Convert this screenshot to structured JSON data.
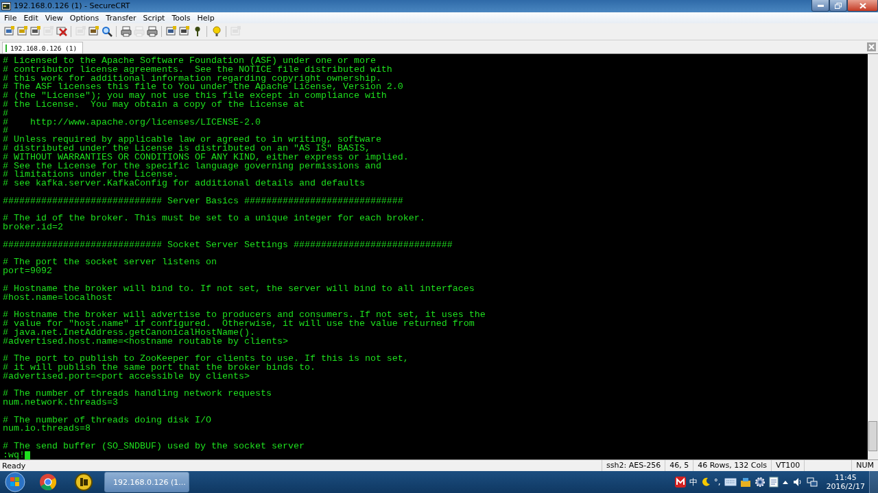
{
  "window": {
    "title": "192.168.0.126 (1) - SecureCRT"
  },
  "menu": [
    "File",
    "Edit",
    "View",
    "Options",
    "Transfer",
    "Script",
    "Tools",
    "Help"
  ],
  "toolbar": [
    [
      {
        "kind": "connect",
        "disabled": false
      },
      {
        "kind": "quick-connect",
        "disabled": false
      },
      {
        "kind": "tab",
        "disabled": false
      },
      {
        "kind": "reconnect",
        "disabled": true
      },
      {
        "kind": "disconnect",
        "disabled": false
      }
    ],
    [
      {
        "kind": "copy",
        "disabled": true
      },
      {
        "kind": "paste",
        "disabled": false
      },
      {
        "kind": "find",
        "disabled": false
      }
    ],
    [
      {
        "kind": "print-setup",
        "disabled": false
      },
      {
        "kind": "print-selection",
        "disabled": true
      },
      {
        "kind": "print",
        "disabled": false
      }
    ],
    [
      {
        "kind": "options",
        "disabled": false
      },
      {
        "kind": "keymap",
        "disabled": false
      },
      {
        "kind": "key",
        "disabled": false
      }
    ],
    [
      {
        "kind": "help",
        "disabled": false
      }
    ],
    [
      {
        "kind": "about",
        "disabled": true
      }
    ]
  ],
  "tabs": [
    {
      "label": "192.168.0.126  (1)",
      "selected": true
    }
  ],
  "terminal": {
    "blocks": [
      [
        "# Licensed to the Apache Software Foundation (ASF) under one or more",
        "# contributor license agreements.  See the NOTICE file distributed with",
        "# this work for additional information regarding copyright ownership.",
        "# The ASF licenses this file to You under the Apache License, Version 2.0",
        "# (the \"License\"); you may not use this file except in compliance with",
        "# the License.  You may obtain a copy of the License at",
        "#",
        "#    http://www.apache.org/licenses/LICENSE-2.0",
        "#",
        "# Unless required by applicable law or agreed to in writing, software",
        "# distributed under the License is distributed on an \"AS IS\" BASIS,",
        "# WITHOUT WARRANTIES OR CONDITIONS OF ANY KIND, either express or implied.",
        "# See the License for the specific language governing permissions and",
        "# limitations under the License.",
        "# see kafka.server.KafkaConfig for additional details and defaults"
      ],
      [
        "############################# Server Basics #############################"
      ],
      [
        "# The id of the broker. This must be set to a unique integer for each broker.",
        "broker.id=2"
      ],
      [
        "############################# Socket Server Settings #############################"
      ],
      [
        "# The port the socket server listens on",
        "port=9092"
      ],
      [
        "# Hostname the broker will bind to. If not set, the server will bind to all interfaces",
        "#host.name=localhost"
      ],
      [
        "# Hostname the broker will advertise to producers and consumers. If not set, it uses the",
        "# value for \"host.name\" if configured.  Otherwise, it will use the value returned from",
        "# java.net.InetAddress.getCanonicalHostName().",
        "#advertised.host.name=<hostname routable by clients>"
      ],
      [
        "# The port to publish to ZooKeeper for clients to use. If this is not set,",
        "# it will publish the same port that the broker binds to.",
        "#advertised.port=<port accessible by clients>"
      ],
      [
        "# The number of threads handling network requests",
        "num.network.threads=3"
      ],
      [
        "# The number of threads doing disk I/O",
        "num.io.threads=8"
      ],
      [
        "# The send buffer (SO_SNDBUF) used by the socket server"
      ]
    ],
    "command": ":wq!"
  },
  "status_bar": {
    "message": "Ready",
    "cells": [
      "ssh2: AES-256",
      "46,  5",
      "46 Rows, 132 Cols",
      "VT100",
      "NUM"
    ]
  },
  "taskbar": {
    "apps": [
      {
        "kind": "browser"
      },
      {
        "kind": "editor"
      }
    ],
    "windows": [
      {
        "label": "192.168.0.126 (1...",
        "selected": true
      }
    ],
    "tray": {
      "ime": "中",
      "punctuation": "°,",
      "time": "11:45",
      "date": "2016/2/17"
    }
  }
}
